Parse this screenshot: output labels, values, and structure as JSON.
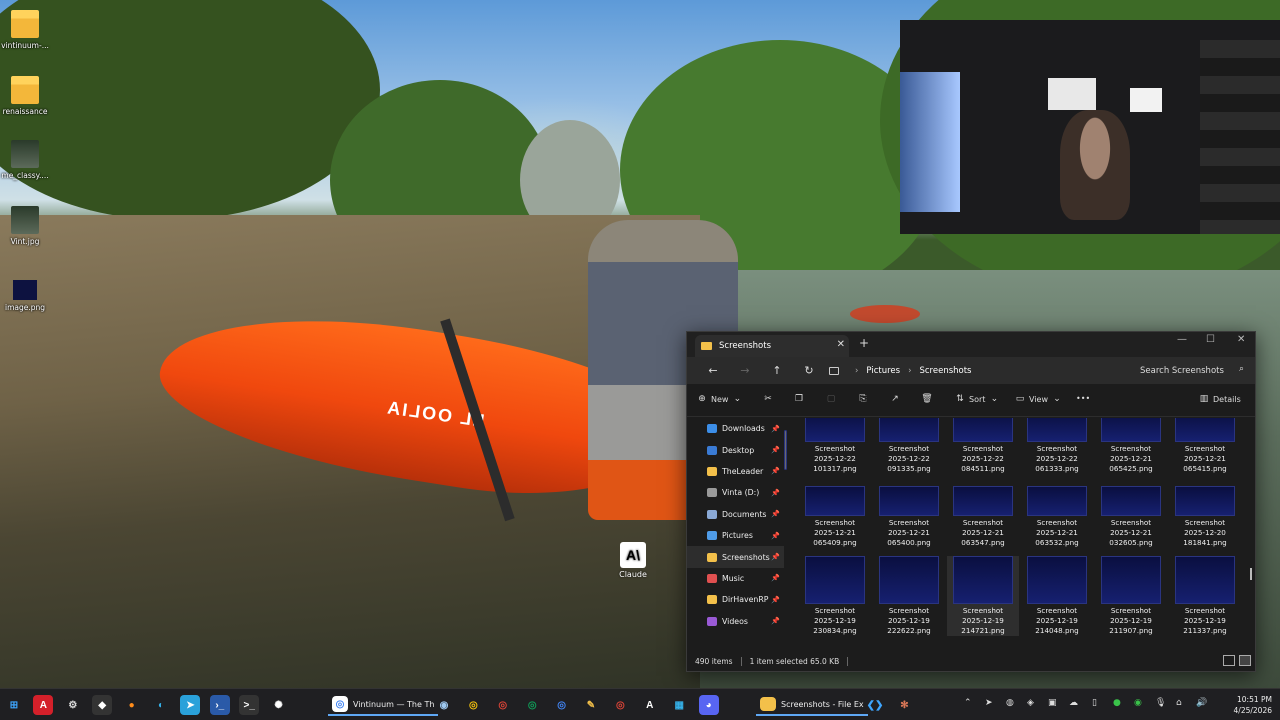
{
  "desktop": {
    "icons": [
      {
        "label": "vintinuum-...",
        "icon": "folder-icon"
      },
      {
        "label": "renaissance",
        "icon": "folder-icon"
      },
      {
        "label": "me_classy....",
        "icon": "image-file-icon"
      },
      {
        "label": "Vint.jpg",
        "icon": "image-file-icon"
      },
      {
        "label": "image.png",
        "icon": "image-file-icon"
      }
    ],
    "claude_shortcut": {
      "glyph": "A\\",
      "label": "Claude"
    },
    "kayak_text": "LL OOLIA"
  },
  "explorer": {
    "tab_title": "Screenshots",
    "tab_close": "✕",
    "new_tab": "+",
    "window_controls": {
      "minimize": "—",
      "maximize": "☐",
      "close": "✕"
    },
    "nav": {
      "back": "←",
      "forward": "→",
      "up": "↑",
      "refresh": "↻"
    },
    "breadcrumb": [
      "Pictures",
      "Screenshots"
    ],
    "search_placeholder": "Search Screenshots",
    "commands": {
      "new": "New",
      "sort": "Sort",
      "view": "View",
      "more": "•••",
      "details": "Details"
    },
    "sidebar": [
      {
        "label": "Downloads",
        "color": "#3c8ee8",
        "pinned": true
      },
      {
        "label": "Desktop",
        "color": "#3a7bd5",
        "pinned": true
      },
      {
        "label": "TheLeader",
        "color": "#f3c04a",
        "pinned": true
      },
      {
        "label": "Vinta (D:)",
        "color": "#9a9a9a",
        "pinned": true
      },
      {
        "label": "Documents",
        "color": "#8aa9d6",
        "pinned": true
      },
      {
        "label": "Pictures",
        "color": "#4f9ce8",
        "pinned": true
      },
      {
        "label": "Screenshots",
        "color": "#f3c04a",
        "pinned": true,
        "active": true
      },
      {
        "label": "Music",
        "color": "#e05050",
        "pinned": true
      },
      {
        "label": "DirHavenRP",
        "color": "#f3c04a",
        "pinned": true
      },
      {
        "label": "Videos",
        "color": "#9a5ad6",
        "pinned": true
      }
    ],
    "files": [
      {
        "l1": "Screenshot",
        "l2": "2025-12-22",
        "l3": "101317.png"
      },
      {
        "l1": "Screenshot",
        "l2": "2025-12-22",
        "l3": "091335.png"
      },
      {
        "l1": "Screenshot",
        "l2": "2025-12-22",
        "l3": "084511.png"
      },
      {
        "l1": "Screenshot",
        "l2": "2025-12-22",
        "l3": "061333.png"
      },
      {
        "l1": "Screenshot",
        "l2": "2025-12-21",
        "l3": "065425.png"
      },
      {
        "l1": "Screenshot",
        "l2": "2025-12-21",
        "l3": "065415.png"
      },
      {
        "l1": "Screenshot",
        "l2": "2025-12-21",
        "l3": "065409.png"
      },
      {
        "l1": "Screenshot",
        "l2": "2025-12-21",
        "l3": "065400.png"
      },
      {
        "l1": "Screenshot",
        "l2": "2025-12-21",
        "l3": "063547.png"
      },
      {
        "l1": "Screenshot",
        "l2": "2025-12-21",
        "l3": "063532.png"
      },
      {
        "l1": "Screenshot",
        "l2": "2025-12-21",
        "l3": "032605.png"
      },
      {
        "l1": "Screenshot",
        "l2": "2025-12-20",
        "l3": "181841.png"
      },
      {
        "l1": "Screenshot",
        "l2": "2025-12-19",
        "l3": "230834.png"
      },
      {
        "l1": "Screenshot",
        "l2": "2025-12-19",
        "l3": "222622.png"
      },
      {
        "l1": "Screenshot",
        "l2": "2025-12-19",
        "l3": "214721.png",
        "selected": true
      },
      {
        "l1": "Screenshot",
        "l2": "2025-12-19",
        "l3": "214048.png"
      },
      {
        "l1": "Screenshot",
        "l2": "2025-12-19",
        "l3": "211907.png"
      },
      {
        "l1": "Screenshot",
        "l2": "2025-12-19",
        "l3": "211337.png"
      }
    ],
    "status": {
      "item_count": "490 items",
      "selection": "1 item selected  65.0 KB"
    }
  },
  "taskbar": {
    "apps": [
      {
        "name": "start-button",
        "glyph": "⊞",
        "color": "#3ea6ff",
        "bg": "transparent"
      },
      {
        "name": "acrobat-app",
        "glyph": "A",
        "color": "#fff",
        "bg": "#d4202a"
      },
      {
        "name": "settings-app",
        "glyph": "⚙",
        "color": "#ddd",
        "bg": "transparent"
      },
      {
        "name": "epic-games-app",
        "glyph": "◆",
        "color": "#fff",
        "bg": "#333"
      },
      {
        "name": "firefox-app",
        "glyph": "●",
        "color": "#ff8c1a",
        "bg": "transparent"
      },
      {
        "name": "edge-app",
        "glyph": "◐",
        "color": "#35b0e8",
        "bg": "transparent"
      },
      {
        "name": "telegram-app",
        "glyph": "➤",
        "color": "#fff",
        "bg": "#2aa1da"
      },
      {
        "name": "powershell-app",
        "glyph": "›_",
        "color": "#fff",
        "bg": "#2a5aa8"
      },
      {
        "name": "terminal-app",
        "glyph": ">_",
        "color": "#fff",
        "bg": "#333"
      },
      {
        "name": "openai-app",
        "glyph": "✺",
        "color": "#fff",
        "bg": "transparent"
      }
    ],
    "active_window": "Vintinuum — The Th",
    "apps2": [
      {
        "name": "steam-app",
        "glyph": "◉",
        "color": "#9ec8f0",
        "bg": "transparent"
      },
      {
        "name": "chrome-app-1",
        "glyph": "◎",
        "color": "#f4c20d",
        "bg": "transparent"
      },
      {
        "name": "chrome-app-2",
        "glyph": "◎",
        "color": "#db4437",
        "bg": "transparent"
      },
      {
        "name": "chrome-app-3",
        "glyph": "◎",
        "color": "#0f9d58",
        "bg": "transparent"
      },
      {
        "name": "chrome-app-4",
        "glyph": "◎",
        "color": "#4285f4",
        "bg": "transparent"
      },
      {
        "name": "pen-app",
        "glyph": "✎",
        "color": "#f3c04a",
        "bg": "transparent"
      },
      {
        "name": "chrome-app-5",
        "glyph": "◎",
        "color": "#db4437",
        "bg": "transparent"
      },
      {
        "name": "anthropic-app",
        "glyph": "A",
        "color": "#fff",
        "bg": "transparent"
      },
      {
        "name": "store-app",
        "glyph": "▦",
        "color": "#35b0e8",
        "bg": "transparent"
      },
      {
        "name": "discord-app",
        "glyph": "◕",
        "color": "#fff",
        "bg": "#5865f2"
      }
    ],
    "explorer_button": "Screenshots - File Ex",
    "apps3": [
      {
        "name": "vscode-app",
        "glyph": "❮❯",
        "color": "#3ea6ff",
        "bg": "transparent"
      },
      {
        "name": "claude-app",
        "glyph": "✻",
        "color": "#d97757",
        "bg": "transparent"
      }
    ],
    "tray_chevron": "⌃",
    "clock_time": "10:51 PM",
    "clock_date": "4/25/2026"
  }
}
